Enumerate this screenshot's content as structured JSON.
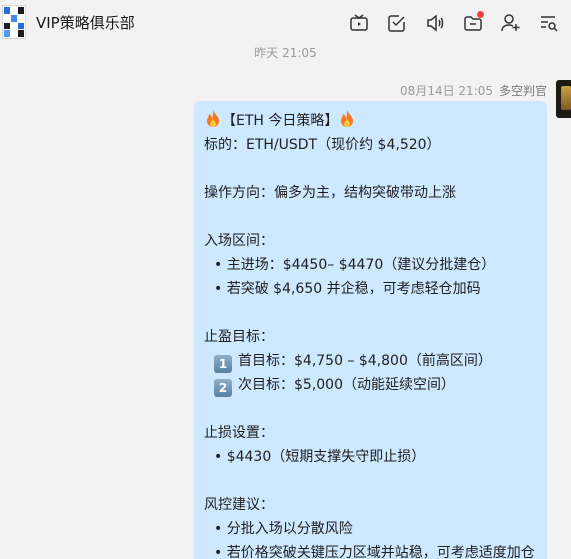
{
  "header": {
    "title": "VIP策略俱乐部",
    "icons": [
      "tv-icon",
      "checkbox-icon",
      "speaker-icon",
      "folder-icon",
      "add-user-icon",
      "list-search-icon"
    ]
  },
  "chat": {
    "time_divider": "昨天 21:05",
    "message": {
      "timestamp": "08月14日 21:05",
      "sender": "多空判官",
      "title": "【ETH 今日策略】",
      "lines": {
        "symbol": "标的：ETH/USDT（现价约 $4,520）",
        "direction": "操作方向：偏多为主，结构突破带动上涨",
        "entry_heading": "入场区间：",
        "entry_1": "• 主进场：$4450– $4470（建议分批建仓）",
        "entry_2": "• 若突破 $4,650 并企稳，可考虑轻仓加码",
        "tp_heading": "止盈目标：",
        "tp_1_num": "1",
        "tp_1": "首目标：$4,750 – $4,800（前高区间）",
        "tp_2_num": "2",
        "tp_2": "次目标：$5,000（动能延续空间）",
        "sl_heading": "止损设置：",
        "sl_1": "• $4430（短期支撑失守即止损）",
        "risk_heading": "风控建议：",
        "risk_1": "• 分批入场以分散风险",
        "risk_2": "• 若价格突破关键压力区域并站稳，可考虑适度加仓"
      }
    }
  },
  "colors": {
    "bubble": "#cde8ff",
    "background": "#f2f2f2",
    "notification_dot": "#f53f3f"
  }
}
